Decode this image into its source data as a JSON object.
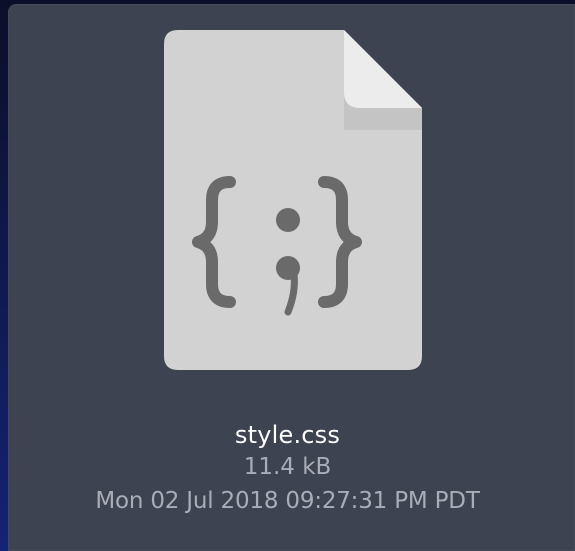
{
  "file": {
    "name": "style.css",
    "size": "11.4 kB",
    "modified": "Mon 02 Jul 2018 09:27:31 PM PDT",
    "icon": "css-file-icon"
  },
  "colors": {
    "panel_bg": "#3e4351",
    "file_body": "#d2d2d2",
    "file_fold": "#ececec",
    "glyph": "#6a6a6a",
    "name_text": "#ffffff",
    "meta_text": "#a9adb8"
  }
}
